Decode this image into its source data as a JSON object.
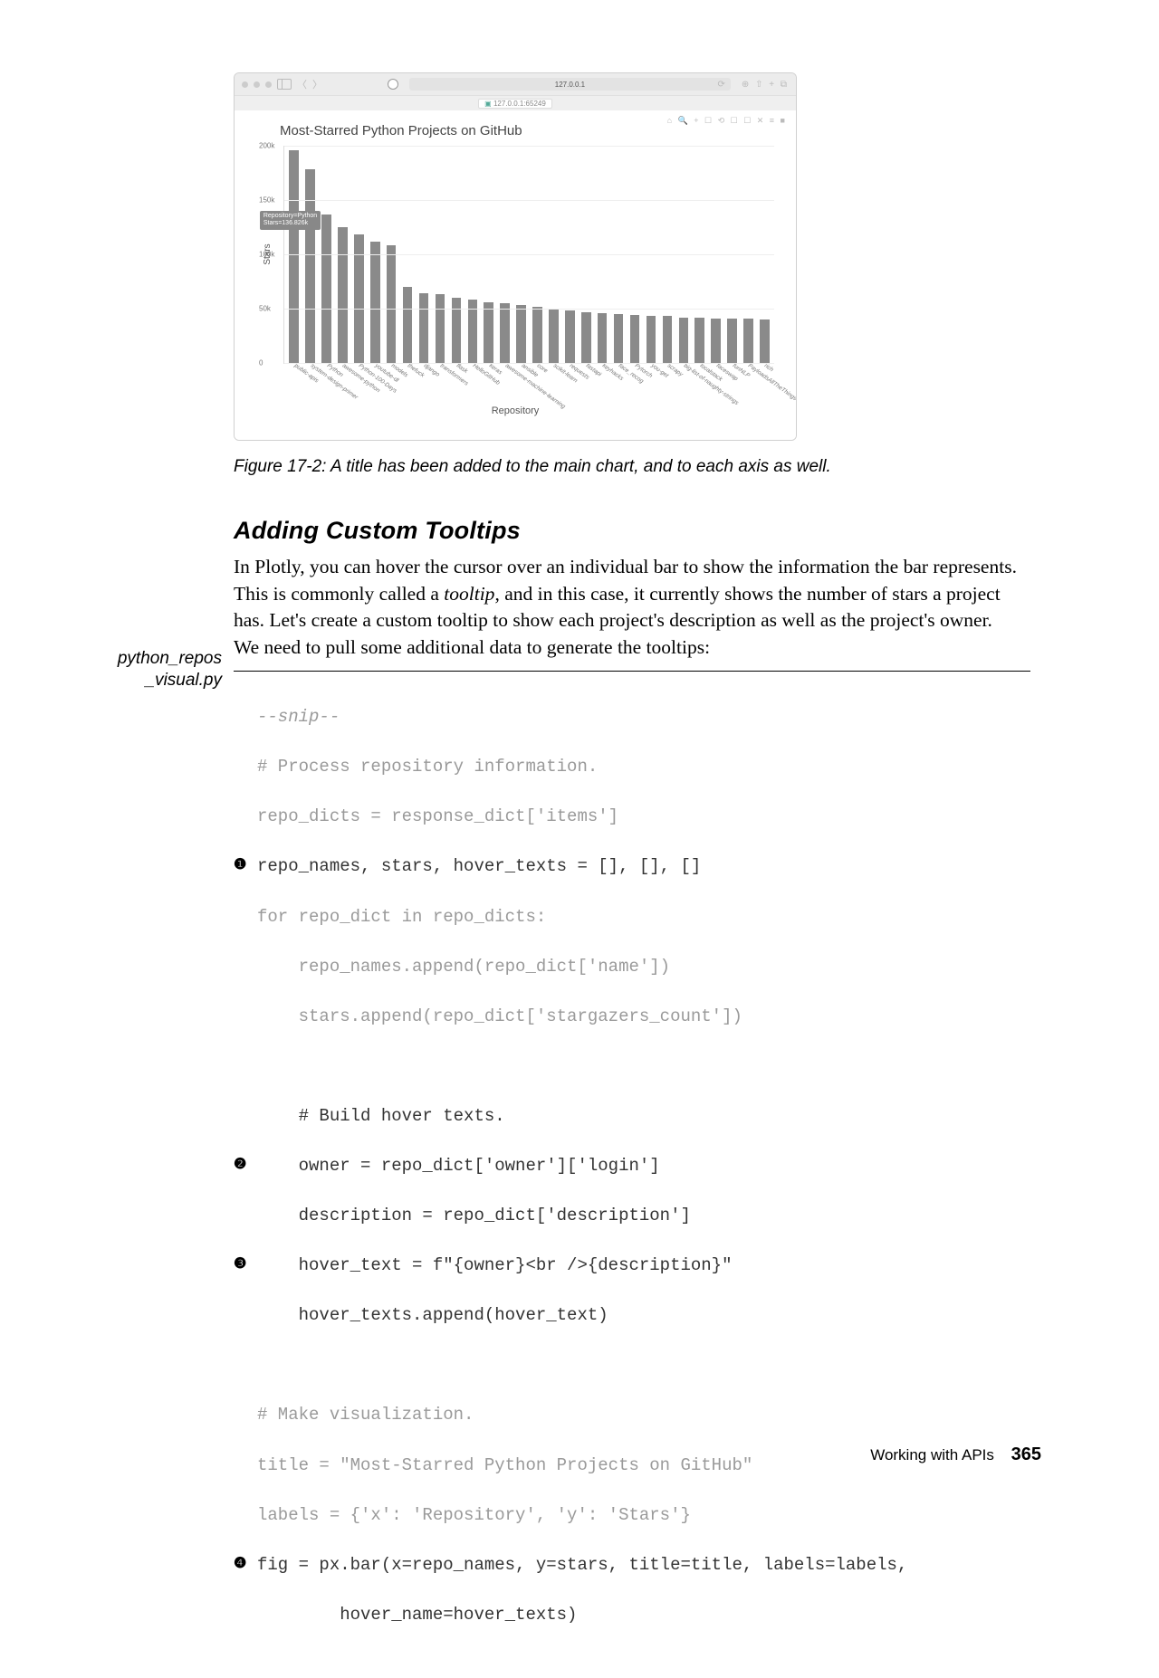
{
  "browser": {
    "url": "127.0.0.1",
    "tab": "127.0.0.1:65249",
    "modebar": "⌂ 🔍 + ☐ ⟲  ☐ ☐ ✕ ≡  ■",
    "toolbar_right": "⊕ ⇧ + ⧉"
  },
  "chart_data": {
    "type": "bar",
    "title": "Most-Starred Python Projects on GitHub",
    "xlabel": "Repository",
    "ylabel": "Stars",
    "ylim": [
      0,
      200000
    ],
    "yticks": [
      {
        "v": 0,
        "label": "0"
      },
      {
        "v": 50000,
        "label": "50k"
      },
      {
        "v": 100000,
        "label": "100k"
      },
      {
        "v": 150000,
        "label": "150k"
      },
      {
        "v": 200000,
        "label": "200k"
      }
    ],
    "categories": [
      "public-apis",
      "system-design-primer",
      "Python",
      "awesome-python",
      "Python-100-Days",
      "youtube-dl",
      "models",
      "thefuck",
      "django",
      "transformers",
      "flask",
      "HelloGitHub",
      "keras",
      "awesome-machine-learning",
      "ansible",
      "core",
      "scikit-learn",
      "requests",
      "fastapi",
      "keyhacks",
      "face_recog",
      "Pytorch",
      "you-get",
      "scrapy",
      "big-list-of-naughty-strings",
      "localstack",
      "faceswap",
      "funNLP",
      "PayloadsAllTheThings",
      "rich"
    ],
    "values": [
      196000,
      178000,
      136.826,
      125000,
      118000,
      112000,
      108000,
      70000,
      64000,
      63000,
      60000,
      58000,
      56000,
      55000,
      53000,
      52000,
      50000,
      48000,
      47000,
      46000,
      45000,
      44000,
      43000,
      43000,
      42000,
      42000,
      41000,
      41000,
      41000,
      40000
    ],
    "tooltip": {
      "index": 2,
      "lines": [
        "Repository=Python",
        "Stars=136.826k"
      ]
    }
  },
  "caption": "Figure 17-2: A title has been added to the main chart, and to each axis as well.",
  "section_title": "Adding Custom Tooltips",
  "para1_a": "In Plotly, you can hover the cursor over an individual bar to show the infor­mation the bar represents. This is commonly called a ",
  "para1_i": "tooltip",
  "para1_b": ", and in this case, it currently shows the number of stars a project has. Let's create a cus­tom tooltip to show each project's description as well as the project's owner.",
  "para2": "We need to pull some additional data to generate the tooltips:",
  "filename_a": "python_repos",
  "filename_b": "_visual.py",
  "code": {
    "l0": "--snip--",
    "l1": "# Process repository information.",
    "l2": "repo_dicts = response_dict['items']",
    "l3": "repo_names, stars, hover_texts = [], [], []",
    "l4": "for repo_dict in repo_dicts:",
    "l5": "    repo_names.append(repo_dict['name'])",
    "l6": "    stars.append(repo_dict['stargazers_count'])",
    "l7": "    # Build hover texts.",
    "l8": "    owner = repo_dict['owner']['login']",
    "l9": "    description = repo_dict['description']",
    "l10": "    hover_text = f\"{owner}<br />{description}\"",
    "l11": "    hover_texts.append(hover_text)",
    "l12": "# Make visualization.",
    "l13": "title = \"Most-Starred Python Projects on GitHub\"",
    "l14": "labels = {'x': 'Repository', 'y': 'Stars'}",
    "l15": "fig = px.bar(x=repo_names, y=stars, title=title, labels=labels,",
    "l16": "        hover_name=hover_texts)"
  },
  "markers": {
    "m1": "❶",
    "m2": "❷",
    "m3": "❸",
    "m4": "❹"
  },
  "footer": {
    "label": "Working with APIs",
    "page": "365"
  }
}
